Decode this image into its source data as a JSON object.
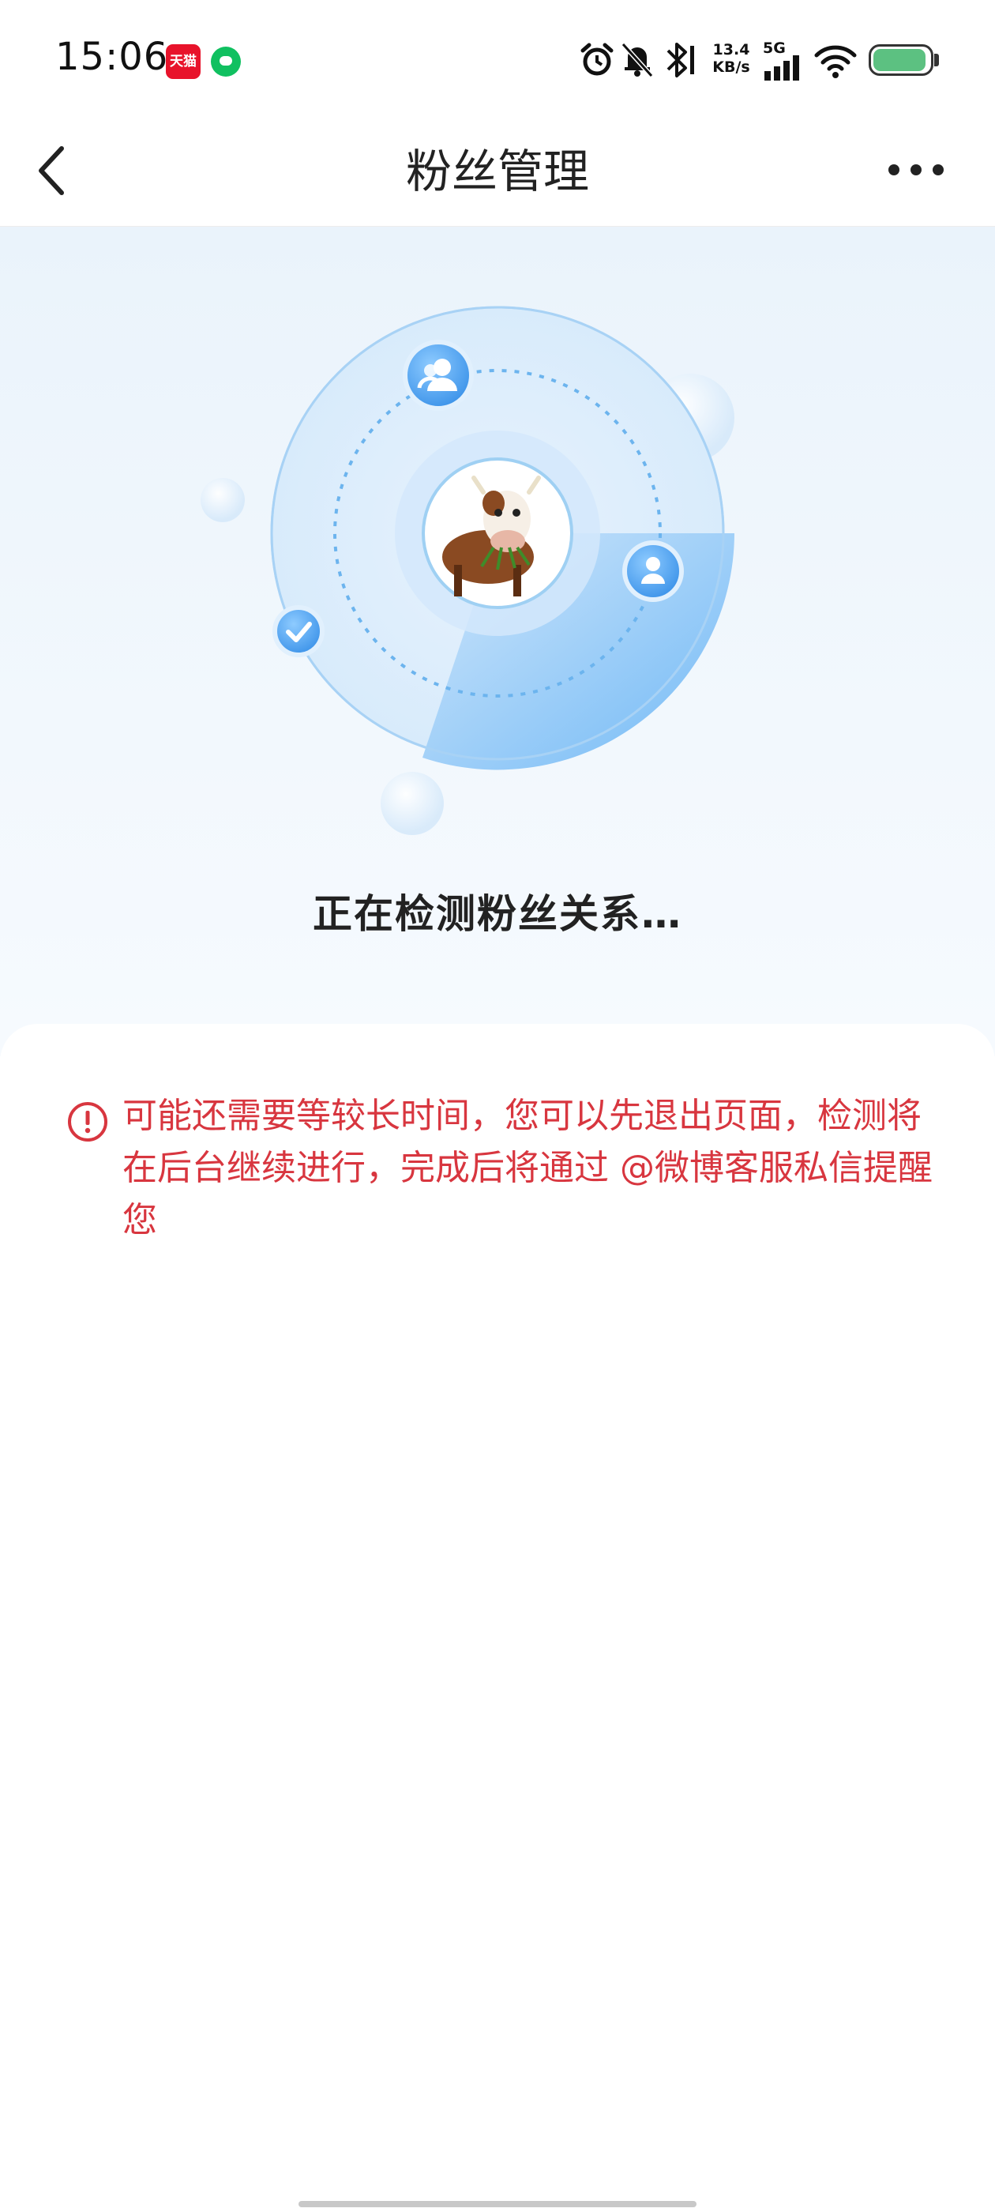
{
  "status_bar": {
    "time": "15:06",
    "tmall_badge": "天猫",
    "net_speed_value": "13.4",
    "net_speed_unit": "KB/s",
    "network_type": "5G",
    "battery_color": "#5cc181"
  },
  "nav": {
    "title": "粉丝管理",
    "back_icon": "chevron-left-icon",
    "more_icon": "more-dots-icon"
  },
  "hero": {
    "status_text": "正在检测粉丝关系…",
    "accent_color": "#5aaef2",
    "icons": [
      "users-icon",
      "user-icon",
      "check-icon"
    ]
  },
  "notice": {
    "icon": "alert-circle-icon",
    "text": "可能还需要等较长时间，您可以先退出页面，检测将在后台继续进行，完成后将通过 @微博客服私信提醒您",
    "color": "#d8363f"
  }
}
